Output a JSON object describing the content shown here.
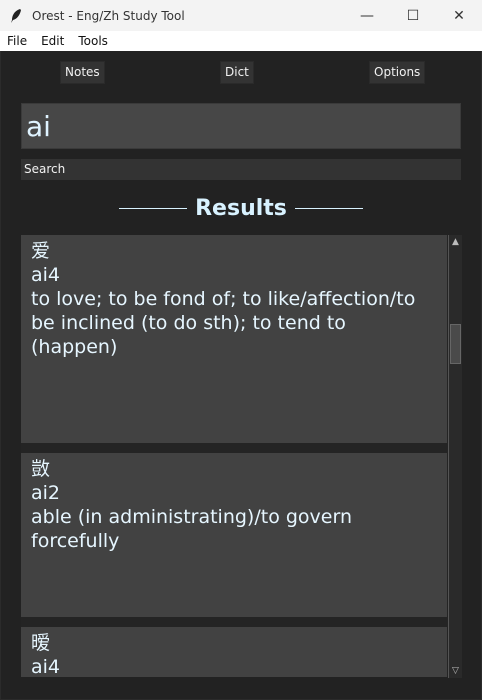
{
  "window": {
    "title": "Orest - Eng/Zh Study Tool",
    "controls": {
      "minimize": "—",
      "maximize": "☐",
      "close": "✕"
    }
  },
  "menu": {
    "file": "File",
    "edit": "Edit",
    "tools": "Tools"
  },
  "nav": {
    "notes": "Notes",
    "dict": "Dict",
    "options": "Options"
  },
  "search": {
    "value": "ai",
    "button": "Search"
  },
  "results": {
    "heading": "Results",
    "entries": [
      {
        "hanzi": "爱",
        "pinyin": "ai4",
        "definition": "to love; to be fond of; to like/affection/to be inclined (to do sth); to tend to (happen)"
      },
      {
        "hanzi": "敳",
        "pinyin": "ai2",
        "definition": "able (in administrating)/to govern forcefully"
      },
      {
        "hanzi": "暧",
        "pinyin": "ai4",
        "definition": ""
      }
    ]
  },
  "colors": {
    "accent_text": "#d8f2ff",
    "card_bg": "#424242",
    "app_bg": "#222222"
  }
}
